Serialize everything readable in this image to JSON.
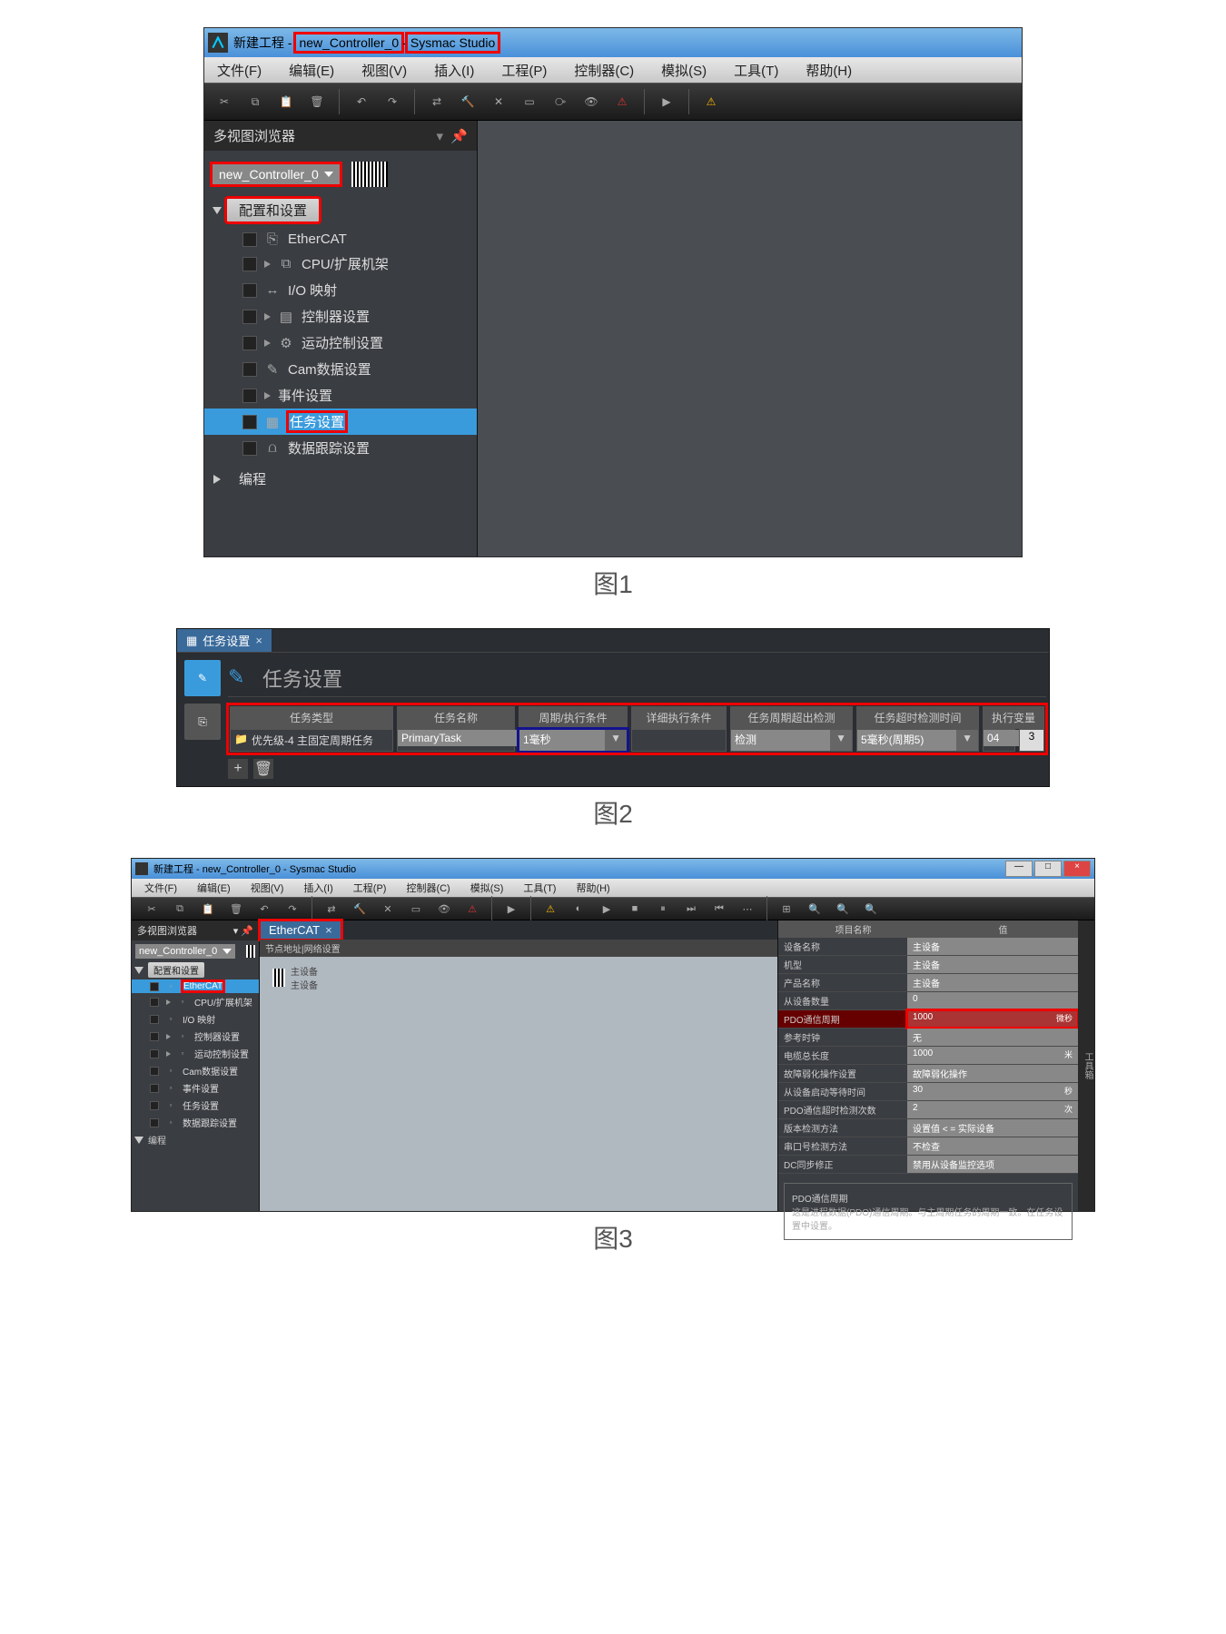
{
  "fig1": {
    "title_prefix": "新建工程 -",
    "title_ctrl": "new_Controller_0",
    "title_sep": " - ",
    "title_app": "Sysmac Studio",
    "menus": [
      "文件(F)",
      "编辑(E)",
      "视图(V)",
      "插入(I)",
      "工程(P)",
      "控制器(C)",
      "模拟(S)",
      "工具(T)",
      "帮助(H)"
    ],
    "sidetitle": "多视图浏览器",
    "controller": "new_Controller_0",
    "cat_config": "配置和设置",
    "tree": [
      {
        "icon": "⎘",
        "label": "EtherCAT"
      },
      {
        "icon": "▶",
        "sub": "⧉",
        "label": "CPU/扩展机架"
      },
      {
        "icon": "↔",
        "label": "I/O 映射"
      },
      {
        "icon": "▶",
        "sub": "▤",
        "label": "控制器设置"
      },
      {
        "icon": "▶",
        "sub": "⚙",
        "label": "运动控制设置"
      },
      {
        "icon": "✎",
        "label": "Cam数据设置"
      },
      {
        "icon": "▶",
        "label": "事件设置"
      },
      {
        "icon": "▦",
        "label": "任务设置",
        "sel": true,
        "hl": true
      },
      {
        "icon": "⩍",
        "label": "数据跟踪设置"
      }
    ],
    "cat_prog": "编程",
    "caption": "图1"
  },
  "fig2": {
    "tab": "任务设置",
    "title": "任务设置",
    "headers": [
      "任务类型",
      "任务名称",
      "周期/执行条件",
      "详细执行条件",
      "任务周期超出检测",
      "任务超时检测时间",
      "执行变量"
    ],
    "row": {
      "type": "优先级-4 主固定周期任务",
      "name": "PrimaryTask",
      "period": "1毫秒",
      "detail": "",
      "overrun": "检测",
      "timeout": "5毫秒(周期5)",
      "v1": "04",
      "v2": "3"
    },
    "caption": "图2"
  },
  "fig3": {
    "title": "新建工程 - new_Controller_0 - Sysmac Studio",
    "menus": [
      "文件(F)",
      "编辑(E)",
      "视图(V)",
      "插入(I)",
      "工程(P)",
      "控制器(C)",
      "模拟(S)",
      "工具(T)",
      "帮助(H)"
    ],
    "sidetitle": "多视图浏览器",
    "controller": "new_Controller_0",
    "cat_config": "配置和设置",
    "tree": [
      "EtherCAT",
      "CPU/扩展机架",
      "I/O 映射",
      "控制器设置",
      "运动控制设置",
      "Cam数据设置",
      "事件设置",
      "任务设置",
      "数据跟踪设置"
    ],
    "cat_prog": "编程",
    "tab": "EtherCAT",
    "subhdr": "节点地址|网络设置",
    "master": "主设备",
    "master2": "主设备",
    "sidevtab": "工具箱",
    "prophdr": [
      "项目名称",
      "值"
    ],
    "props": [
      [
        "设备名称",
        "主设备"
      ],
      [
        "机型",
        "主设备"
      ],
      [
        "产品名称",
        "主设备"
      ],
      [
        "从设备数量",
        "0"
      ],
      [
        "PDO通信周期",
        "1000",
        "微秒",
        true
      ],
      [
        "参考时钟",
        "无"
      ],
      [
        "电缆总长度",
        "1000",
        "米"
      ],
      [
        "故障弱化操作设置",
        "故障弱化操作"
      ],
      [
        "从设备启动等待时间",
        "30",
        "秒"
      ],
      [
        "PDO通信超时检测次数",
        "2",
        "次"
      ],
      [
        "版本检测方法",
        "设置值 < = 实际设备"
      ],
      [
        "串口号检测方法",
        "不检查"
      ],
      [
        "DC同步修正",
        "禁用从设备监控选项"
      ]
    ],
    "hinthdr": "PDO通信周期",
    "hint": "这是进程数据(PDO)通信周期。与主周期任务的周期一致。在任务设置中设置。",
    "caption": "图3"
  }
}
